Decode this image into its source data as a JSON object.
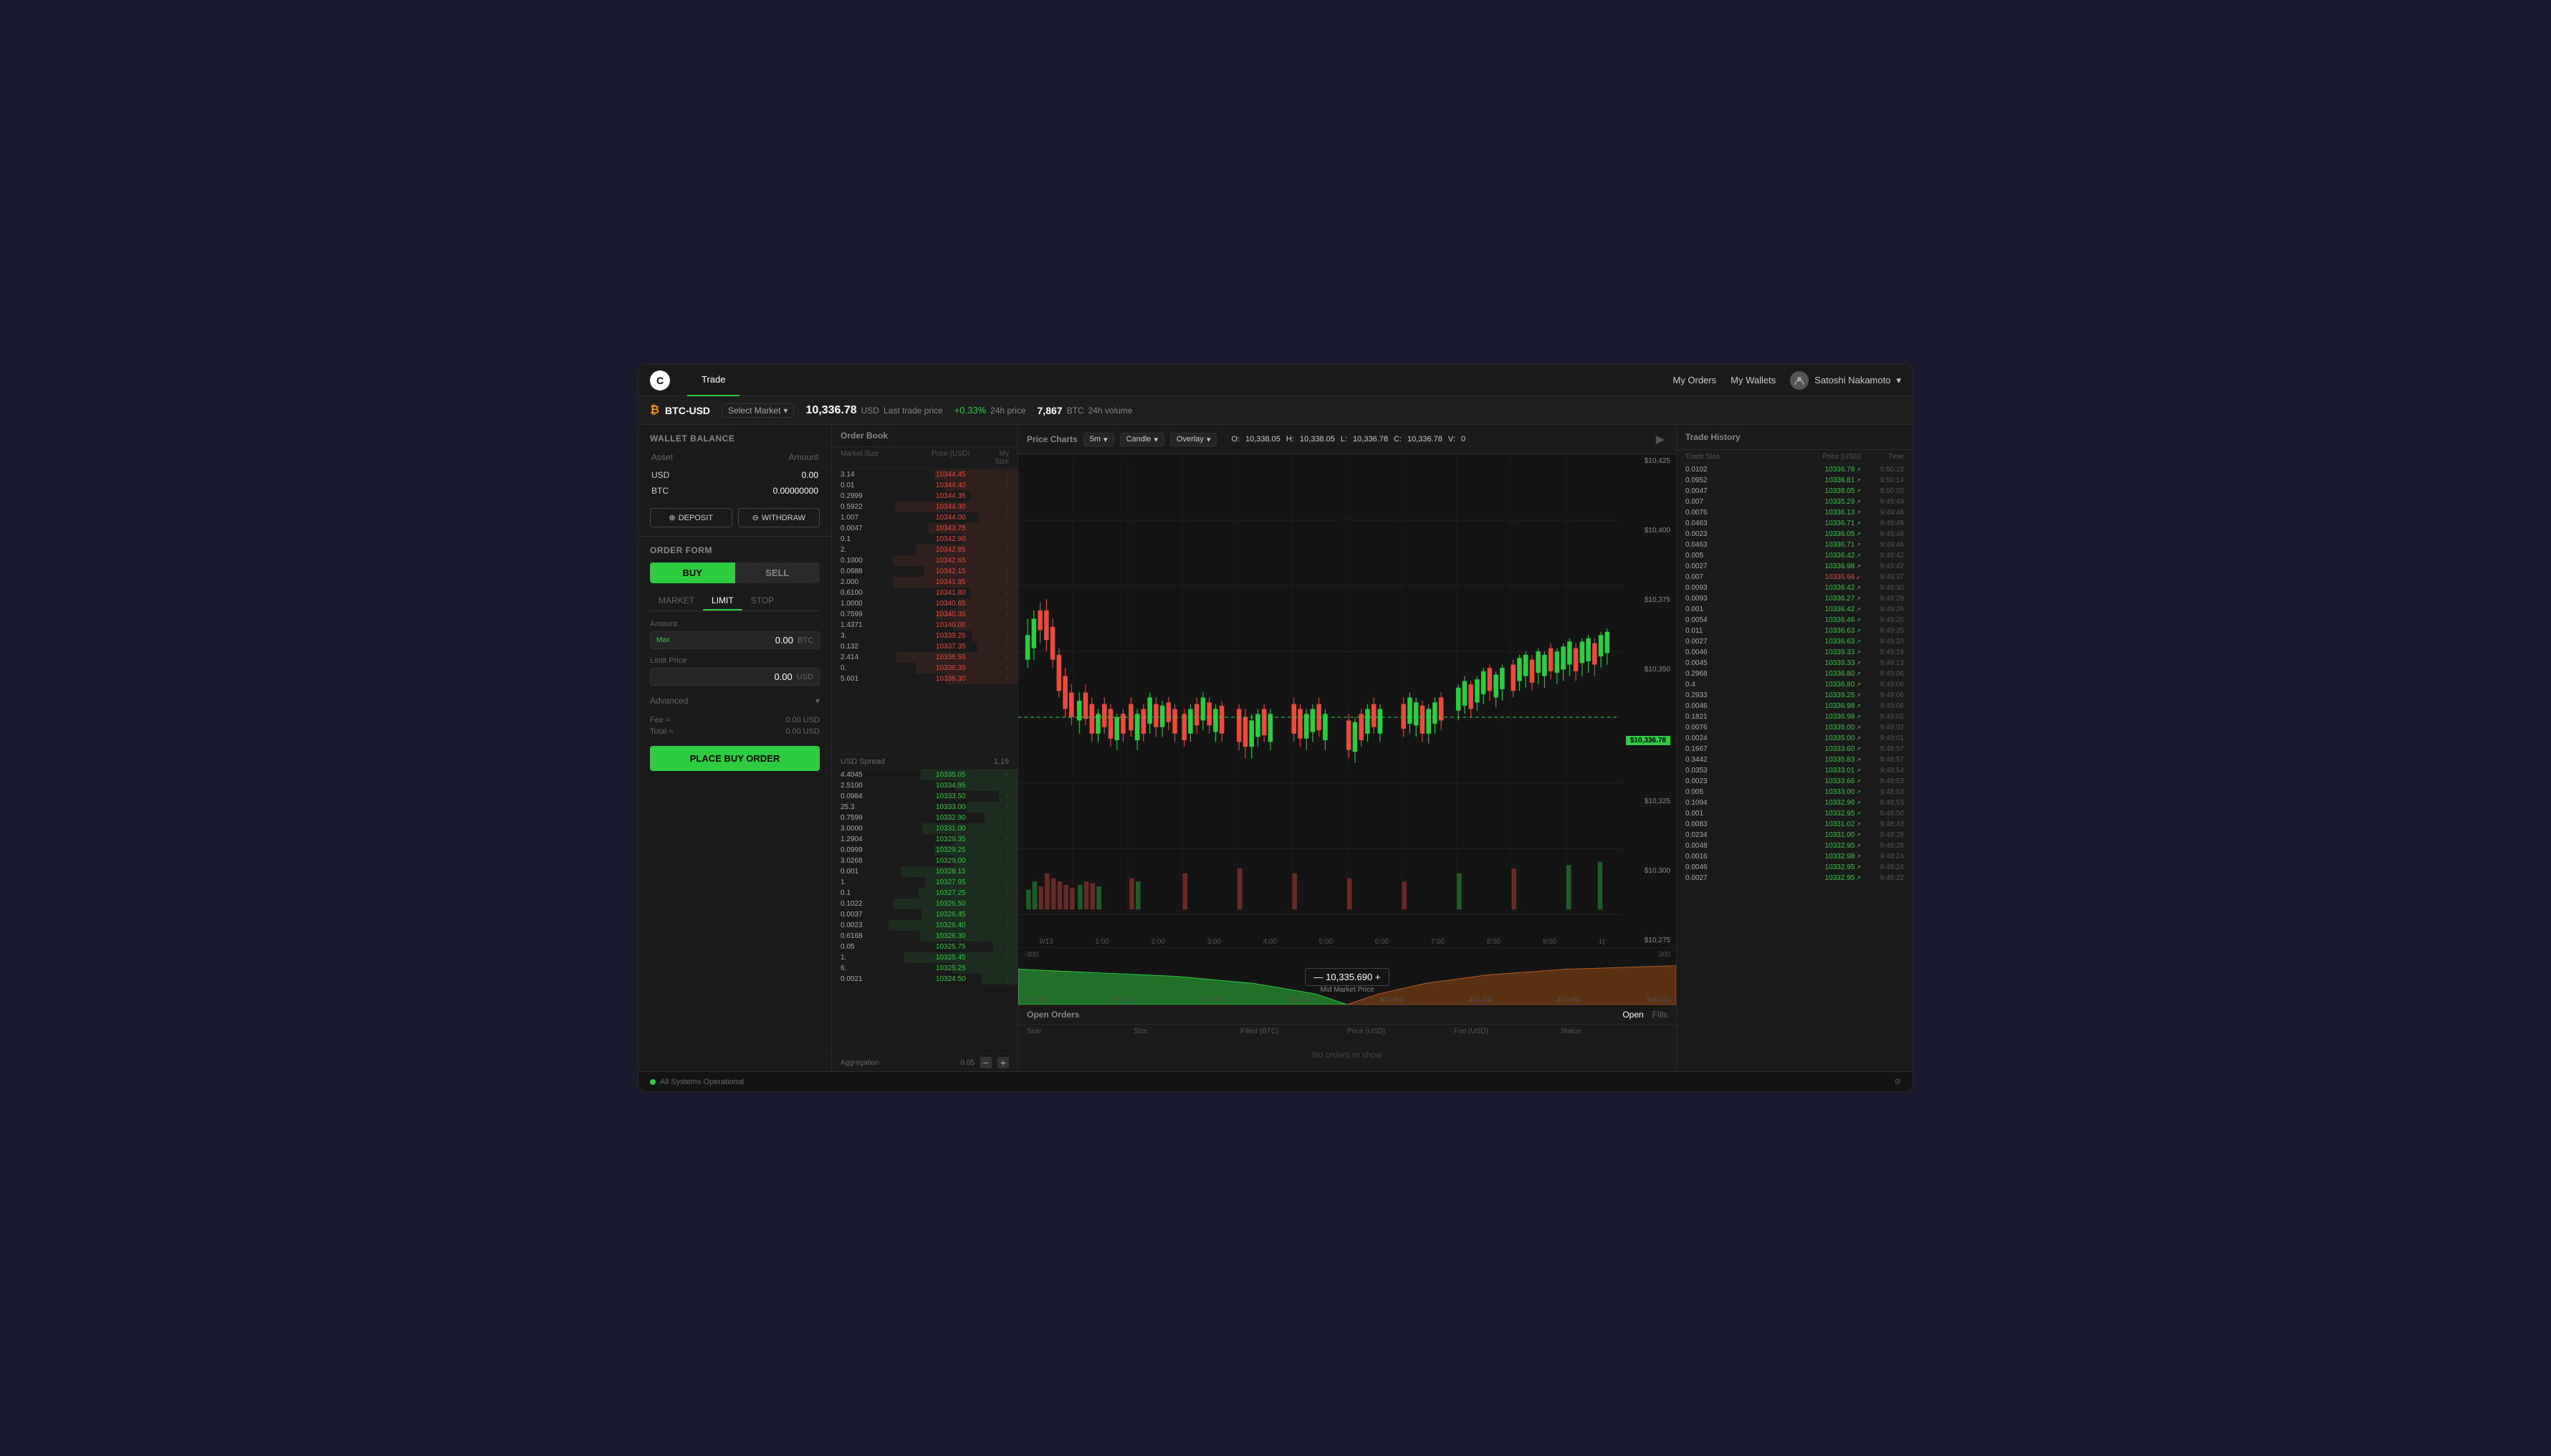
{
  "app": {
    "logo": "C",
    "tabs": [
      {
        "label": "Trade",
        "active": true
      }
    ],
    "nav_right": {
      "my_orders": "My Orders",
      "my_wallets": "My Wallets",
      "user_name": "Satoshi Nakamoto"
    }
  },
  "market_bar": {
    "pair": "BTC-USD",
    "select_market": "Select Market",
    "last_price": "10,336.78",
    "currency": "USD",
    "last_trade_label": "Last trade price",
    "price_change": "+0.33%",
    "change_label": "24h price",
    "volume": "7,867",
    "volume_currency": "BTC",
    "volume_label": "24h volume"
  },
  "wallet": {
    "title": "Wallet Balance",
    "asset_header": "Asset",
    "amount_header": "Amount",
    "assets": [
      {
        "name": "USD",
        "amount": "0.00"
      },
      {
        "name": "BTC",
        "amount": "0.00000000"
      }
    ],
    "deposit_btn": "DEPOSIT",
    "withdraw_btn": "WITHDRAW"
  },
  "order_form": {
    "title": "Order Form",
    "buy_label": "BUY",
    "sell_label": "SELL",
    "types": [
      "MARKET",
      "LIMIT",
      "STOP"
    ],
    "active_type": "LIMIT",
    "amount_label": "Amount",
    "amount_value": "0.00",
    "amount_currency": "BTC",
    "amount_max": "Max",
    "limit_price_label": "Limit Price",
    "limit_price_value": "0.00",
    "limit_price_currency": "USD",
    "advanced_label": "Advanced",
    "fee_label": "Fee ≈",
    "fee_value": "0.00 USD",
    "total_label": "Total ≈",
    "total_value": "0.00 USD",
    "place_order_btn": "PLACE BUY ORDER"
  },
  "order_book": {
    "title": "Order Book",
    "col_market_size": "Market Size",
    "col_price": "Price (USD)",
    "col_my_size": "My Size",
    "asks": [
      {
        "size": "3.14",
        "price": "10344.45",
        "mysize": "-"
      },
      {
        "size": "0.01",
        "price": "10344.40",
        "mysize": "-"
      },
      {
        "size": "0.2999",
        "price": "10344.35",
        "mysize": "-"
      },
      {
        "size": "0.5922",
        "price": "10344.30",
        "mysize": "-"
      },
      {
        "size": "1.007",
        "price": "10344.00",
        "mysize": "-"
      },
      {
        "size": "0.0047",
        "price": "10343.75",
        "mysize": "-"
      },
      {
        "size": "0.1",
        "price": "10342.90",
        "mysize": "-"
      },
      {
        "size": "2.",
        "price": "10342.85",
        "mysize": "-"
      },
      {
        "size": "0.1000",
        "price": "10342.65",
        "mysize": "-"
      },
      {
        "size": "0.0688",
        "price": "10342.15",
        "mysize": "-"
      },
      {
        "size": "2.000",
        "price": "10341.95",
        "mysize": "-"
      },
      {
        "size": "0.6100",
        "price": "10341.80",
        "mysize": "-"
      },
      {
        "size": "1.0000",
        "price": "10340.65",
        "mysize": "-"
      },
      {
        "size": "0.7599",
        "price": "10340.35",
        "mysize": "-"
      },
      {
        "size": "1.4371",
        "price": "10340.00",
        "mysize": "-"
      },
      {
        "size": "3.",
        "price": "10339.25",
        "mysize": "-"
      },
      {
        "size": "0.132",
        "price": "10337.35",
        "mysize": "-"
      },
      {
        "size": "2.414",
        "price": "10336.55",
        "mysize": "-"
      },
      {
        "size": "0.",
        "price": "10336.35",
        "mysize": "-"
      },
      {
        "size": "5.601",
        "price": "10336.30",
        "mysize": "-"
      }
    ],
    "spread_label": "USD Spread",
    "spread_value": "1.19",
    "bids": [
      {
        "size": "4.4045",
        "price": "10335.05",
        "mysize": "-"
      },
      {
        "size": "2.5100",
        "price": "10334.95",
        "mysize": "-"
      },
      {
        "size": "0.0984",
        "price": "10333.50",
        "mysize": "-"
      },
      {
        "size": "25.3",
        "price": "10333.00",
        "mysize": "-"
      },
      {
        "size": "0.7599",
        "price": "10332.90",
        "mysize": "-"
      },
      {
        "size": "3.0000",
        "price": "10331.00",
        "mysize": "-"
      },
      {
        "size": "1.2904",
        "price": "10329.35",
        "mysize": "-"
      },
      {
        "size": "0.0999",
        "price": "10329.25",
        "mysize": "-"
      },
      {
        "size": "3.0268",
        "price": "10329.00",
        "mysize": "-"
      },
      {
        "size": "0.001",
        "price": "10328.15",
        "mysize": "-"
      },
      {
        "size": "1.",
        "price": "10327.95",
        "mysize": "-"
      },
      {
        "size": "0.1",
        "price": "10327.25",
        "mysize": "-"
      },
      {
        "size": "0.1022",
        "price": "10326.50",
        "mysize": "-"
      },
      {
        "size": "0.0037",
        "price": "10326.45",
        "mysize": "-"
      },
      {
        "size": "0.0023",
        "price": "10326.40",
        "mysize": "-"
      },
      {
        "size": "0.6168",
        "price": "10326.30",
        "mysize": "-"
      },
      {
        "size": "0.05",
        "price": "10325.75",
        "mysize": "-"
      },
      {
        "size": "1.",
        "price": "10325.45",
        "mysize": "-"
      },
      {
        "size": "6.",
        "price": "10325.25",
        "mysize": "-"
      },
      {
        "size": "0.0021",
        "price": "10324.50",
        "mysize": "-"
      }
    ],
    "aggregation_label": "Aggregation",
    "aggregation_value": "0.05"
  },
  "price_charts": {
    "title": "Price Charts",
    "timeframe": "5m",
    "chart_type": "Candle",
    "overlay": "Overlay",
    "ohlcv": {
      "o_label": "O:",
      "o_val": "10,338.05",
      "h_label": "H:",
      "h_val": "10,338.05",
      "l_label": "L:",
      "l_val": "10,336.78",
      "c_label": "C:",
      "c_val": "10,336.78",
      "v_label": "V:",
      "v_val": "0"
    },
    "price_levels": [
      "$10,425",
      "$10,400",
      "$10,375",
      "$10,350",
      "$10,325",
      "$10,300",
      "$10,275"
    ],
    "current_price": "$10,336.78",
    "time_labels": [
      "9/13",
      "1:00",
      "2:00",
      "3:00",
      "4:00",
      "5:00",
      "6:00",
      "7:00",
      "8:00",
      "9:00",
      "1("
    ],
    "mid_price": "10,335.690",
    "mid_price_label": "Mid Market Price",
    "depth_left": "-300",
    "depth_right": "300",
    "depth_prices": [
      "$10,180",
      "$10,230",
      "$10,280",
      "$10,330",
      "$10,380",
      "$10,430",
      "$10,480",
      "$10,530"
    ]
  },
  "open_orders": {
    "title": "Open Orders",
    "tabs": [
      "Open",
      "Fills"
    ],
    "active_tab": "Open",
    "columns": [
      "Side",
      "Size",
      "Filled (BTC)",
      "Price (USD)",
      "Fee (USD)",
      "Status"
    ],
    "empty_message": "No orders to show"
  },
  "trade_history": {
    "title": "Trade History",
    "col_size": "Trade Size",
    "col_price": "Price (USD)",
    "col_time": "Time",
    "trades": [
      {
        "size": "0.0102",
        "price": "10336.78",
        "dir": "up",
        "time": "9:50:15"
      },
      {
        "size": "0.0952",
        "price": "10336.81",
        "dir": "up",
        "time": "9:50:14"
      },
      {
        "size": "0.0047",
        "price": "10338.05",
        "dir": "up",
        "time": "9:50:02"
      },
      {
        "size": "0.007",
        "price": "10335.29",
        "dir": "up",
        "time": "9:49:49"
      },
      {
        "size": "0.0076",
        "price": "10336.13",
        "dir": "up",
        "time": "9:49:48"
      },
      {
        "size": "0.0463",
        "price": "10336.71",
        "dir": "up",
        "time": "9:49:48"
      },
      {
        "size": "0.0023",
        "price": "10336.05",
        "dir": "up",
        "time": "9:49:48"
      },
      {
        "size": "0.0463",
        "price": "10336.71",
        "dir": "up",
        "time": "9:49:48"
      },
      {
        "size": "0.005",
        "price": "10336.42",
        "dir": "up",
        "time": "9:49:42"
      },
      {
        "size": "0.0027",
        "price": "10336.98",
        "dir": "up",
        "time": "9:49:42"
      },
      {
        "size": "0.007",
        "price": "10336.66",
        "dir": "down",
        "time": "9:49:37"
      },
      {
        "size": "0.0093",
        "price": "10336.42",
        "dir": "up",
        "time": "9:49:30"
      },
      {
        "size": "0.0093",
        "price": "10336.27",
        "dir": "up",
        "time": "9:49:28"
      },
      {
        "size": "0.001",
        "price": "10336.42",
        "dir": "up",
        "time": "9:49:26"
      },
      {
        "size": "0.0054",
        "price": "10336.46",
        "dir": "up",
        "time": "9:49:20"
      },
      {
        "size": "0.011",
        "price": "10336.63",
        "dir": "up",
        "time": "9:49:20"
      },
      {
        "size": "0.0027",
        "price": "10336.63",
        "dir": "up",
        "time": "9:49:20"
      },
      {
        "size": "0.0046",
        "price": "10339.33",
        "dir": "up",
        "time": "9:49:19"
      },
      {
        "size": "0.0045",
        "price": "10339.33",
        "dir": "up",
        "time": "9:49:13"
      },
      {
        "size": "0.2968",
        "price": "10336.80",
        "dir": "up",
        "time": "9:49:06"
      },
      {
        "size": "0.4",
        "price": "10336.80",
        "dir": "up",
        "time": "9:49:06"
      },
      {
        "size": "0.2933",
        "price": "10339.25",
        "dir": "up",
        "time": "9:49:06"
      },
      {
        "size": "0.0046",
        "price": "10336.98",
        "dir": "up",
        "time": "9:49:06"
      },
      {
        "size": "0.1821",
        "price": "10336.98",
        "dir": "up",
        "time": "9:49:02"
      },
      {
        "size": "0.0076",
        "price": "10335.00",
        "dir": "up",
        "time": "9:49:02"
      },
      {
        "size": "0.0024",
        "price": "10335.00",
        "dir": "up",
        "time": "9:49:01"
      },
      {
        "size": "0.1667",
        "price": "10333.60",
        "dir": "up",
        "time": "9:48:57"
      },
      {
        "size": "0.3442",
        "price": "10335.83",
        "dir": "up",
        "time": "9:48:57"
      },
      {
        "size": "0.0353",
        "price": "10333.01",
        "dir": "up",
        "time": "9:48:54"
      },
      {
        "size": "0.0023",
        "price": "10333.66",
        "dir": "up",
        "time": "9:48:53"
      },
      {
        "size": "0.005",
        "price": "10333.00",
        "dir": "up",
        "time": "9:48:53"
      },
      {
        "size": "0.1094",
        "price": "10332.96",
        "dir": "up",
        "time": "9:48:53"
      },
      {
        "size": "0.001",
        "price": "10332.95",
        "dir": "up",
        "time": "9:48:50"
      },
      {
        "size": "0.0083",
        "price": "10331.02",
        "dir": "up",
        "time": "9:48:43"
      },
      {
        "size": "0.0234",
        "price": "10331.00",
        "dir": "up",
        "time": "9:48:28"
      },
      {
        "size": "0.0048",
        "price": "10332.95",
        "dir": "up",
        "time": "9:48:28"
      },
      {
        "size": "0.0016",
        "price": "10332.98",
        "dir": "up",
        "time": "9:48:24"
      },
      {
        "size": "0.0046",
        "price": "10332.95",
        "dir": "up",
        "time": "9:48:24"
      },
      {
        "size": "0.0027",
        "price": "10332.95",
        "dir": "up",
        "time": "9:48:22"
      }
    ]
  },
  "status_bar": {
    "status_text": "All Systems Operational",
    "status_color": "#2ecc40"
  }
}
